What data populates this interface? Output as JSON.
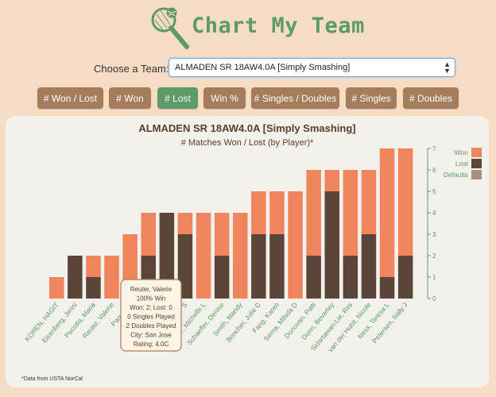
{
  "app": {
    "title": "Chart My Team"
  },
  "team_selector": {
    "label": "Choose a Team:",
    "selected": "ALMADEN SR 18AW4.0A [Simply Smashing]"
  },
  "buttons": [
    {
      "label": "# Won / Lost",
      "active": false
    },
    {
      "label": "# Won",
      "active": false
    },
    {
      "label": "# Lost",
      "active": true
    },
    {
      "label": "Win %",
      "active": false
    },
    {
      "label": "# Singles / Doubles",
      "active": false
    },
    {
      "label": "# Singles",
      "active": false
    },
    {
      "label": "# Doubles",
      "active": false
    }
  ],
  "colors": {
    "won": "#f0845c",
    "lost": "#5b4438",
    "defaults": "#a88f78",
    "accent_green": "#5d9a67",
    "button_brown": "#a57d5b"
  },
  "chart_data": {
    "type": "bar",
    "title": "ALMADEN SR 18AW4.0A [Simply Smashing]",
    "subtitle": "# Matches Won / Lost (by Player)*",
    "categories": [
      "KOREN, HAGIT",
      "Eisenberg, Jenni",
      "Pecotta, Maria",
      "Reuter, Valerie",
      "Paquet, J",
      "C",
      "",
      "S",
      "Jr., Michelle L",
      "Schaeffer, Denise",
      "Smith, Mandy",
      "Boncher, Julie C",
      "Fang, Karen",
      "Serna, Milsda D",
      "Donovan, Patti",
      "Dunn, Beverley",
      "Sidartawan-Lie, Rini",
      "van der Hulst, Nicole",
      "Ness, Teresa L",
      "Petersen, Sally J"
    ],
    "series": [
      {
        "name": "Won",
        "values": [
          1,
          0,
          1,
          2,
          3,
          2,
          0,
          1,
          4,
          2,
          4,
          2,
          2,
          5,
          4,
          1,
          4,
          3,
          6,
          5
        ]
      },
      {
        "name": "Lost",
        "values": [
          0,
          2,
          1,
          0,
          0,
          2,
          4,
          3,
          0,
          2,
          0,
          3,
          3,
          0,
          2,
          5,
          2,
          3,
          1,
          2
        ]
      },
      {
        "name": "Defaults",
        "values": [
          0,
          0,
          0,
          0,
          0,
          0,
          0,
          0,
          0,
          0,
          0,
          0,
          0,
          0,
          0,
          0,
          0,
          0,
          0,
          0
        ]
      }
    ],
    "stacked": true,
    "ylim": [
      0,
      7
    ],
    "yticks": [
      "0",
      "1",
      "2",
      "3",
      "4",
      "5",
      "6",
      "7"
    ],
    "y_axis_side": "right",
    "legend": [
      "Won",
      "Lost",
      "Defaults"
    ],
    "legend_position": "top-right",
    "grid": false
  },
  "tooltip": {
    "lines": [
      "Reuter, Valerie",
      "100% Win",
      "Won: 2; Lost: 0",
      "0 Singles Played",
      "2 Doubles Played",
      "City: San Jose",
      "Rating: 4.0C"
    ]
  },
  "footnote": "*Data from USTA NorCal"
}
